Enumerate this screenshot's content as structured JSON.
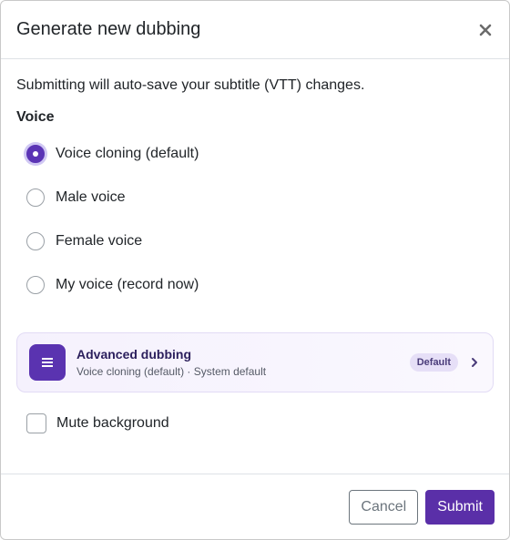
{
  "dialog": {
    "title": "Generate new dubbing",
    "close_icon": "close-icon"
  },
  "body": {
    "note": "Submitting will auto-save your subtitle (VTT) changes.",
    "voice_label": "Voice",
    "voice_options": [
      {
        "label": "Voice cloning (default)",
        "checked": true
      },
      {
        "label": "Male voice",
        "checked": false
      },
      {
        "label": "Female voice",
        "checked": false
      },
      {
        "label": "My voice (record now)",
        "checked": false
      }
    ],
    "advanced": {
      "icon": "menu-icon",
      "title": "Advanced dubbing",
      "subtitle": "Voice cloning (default) · System default",
      "badge": "Default",
      "chevron_icon": "chevron-right-icon"
    },
    "mute_background": {
      "label": "Mute background",
      "checked": false
    }
  },
  "footer": {
    "cancel_label": "Cancel",
    "submit_label": "Submit"
  },
  "colors": {
    "accent": "#5a2fa8",
    "card_bg": "#f5f1fd",
    "badge_bg": "#e6dff7"
  }
}
